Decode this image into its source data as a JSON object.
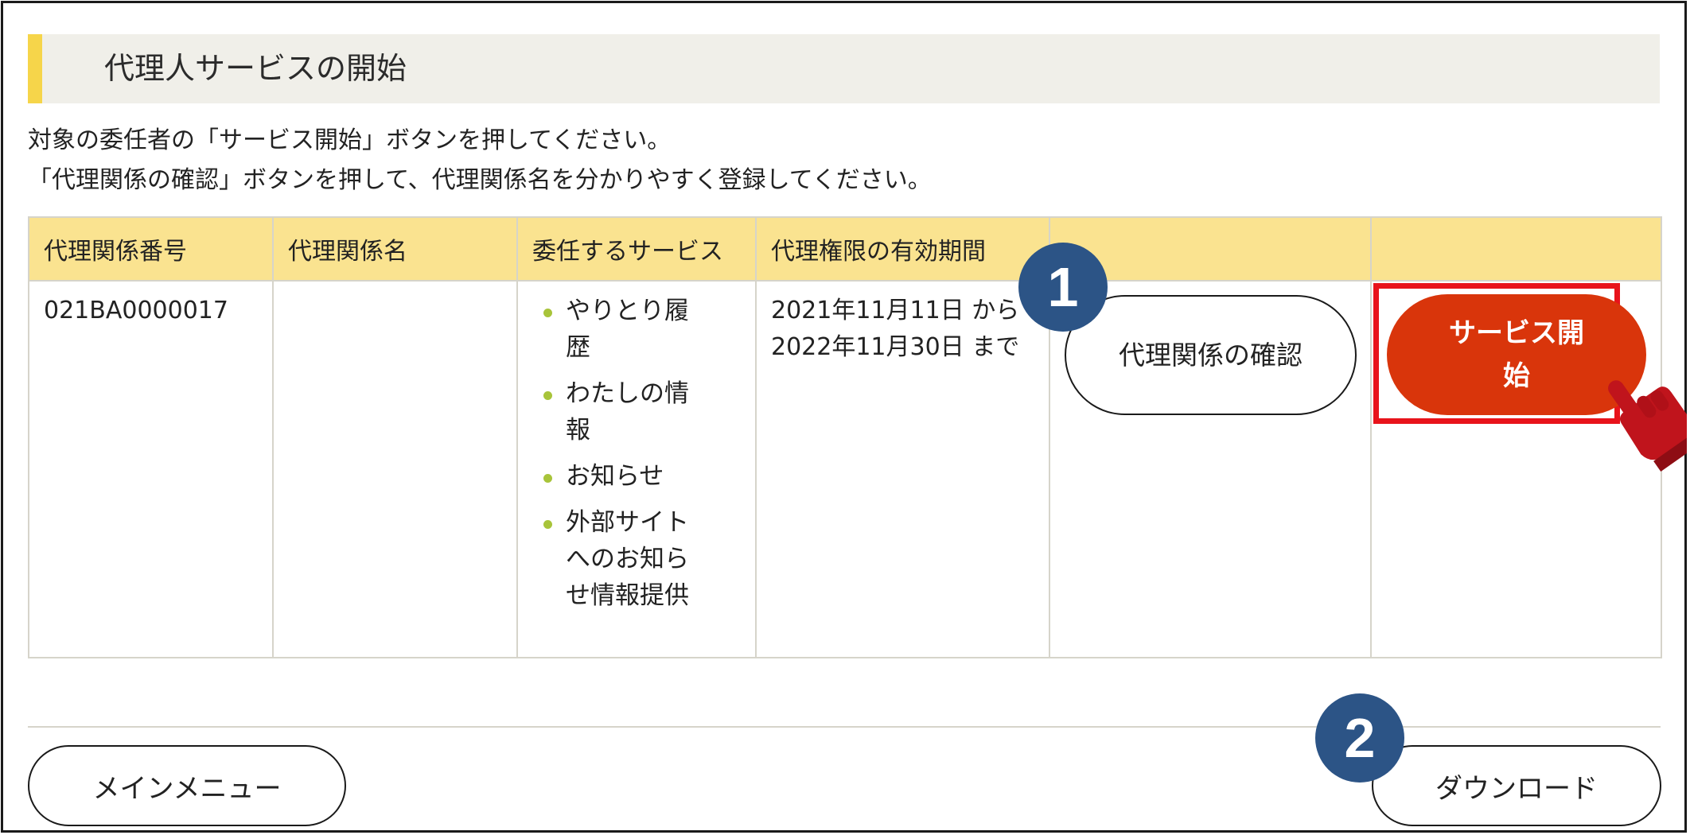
{
  "header": {
    "title": "代理人サービスの開始"
  },
  "instructions": {
    "line1": "対象の委任者の「サービス開始」ボタンを押してください。",
    "line2": "「代理関係の確認」ボタンを押して、代理関係名を分かりやすく登録してください。"
  },
  "table": {
    "headers": [
      "代理関係番号",
      "代理関係名",
      "委任するサービス",
      "代理権限の有効期間",
      "",
      ""
    ],
    "rows": [
      {
        "number": "021BA0000017",
        "name": "",
        "services": [
          "やりとり履歴",
          "わたしの情報",
          "お知らせ",
          "外部サイトへのお知らせ情報提供"
        ],
        "period_from": "2021年11月11日 から",
        "period_to": "2022年11月30日 まで",
        "confirm_label": "代理関係の確認",
        "start_label": "サービス開始"
      }
    ]
  },
  "badges": {
    "one": "1",
    "two": "2"
  },
  "footer": {
    "menu_label": "メインメニュー",
    "download_label": "ダウンロード"
  },
  "icons": {
    "pointer": "hand-pointer-icon",
    "bullet": "bullet-dot-icon"
  },
  "colors": {
    "accent_yellow": "#f6d54a",
    "header_row": "#fae390",
    "start_button": "#d9350b",
    "highlight_border": "#e8131b",
    "badge": "#2c5486",
    "bullet": "#a8c43a"
  }
}
